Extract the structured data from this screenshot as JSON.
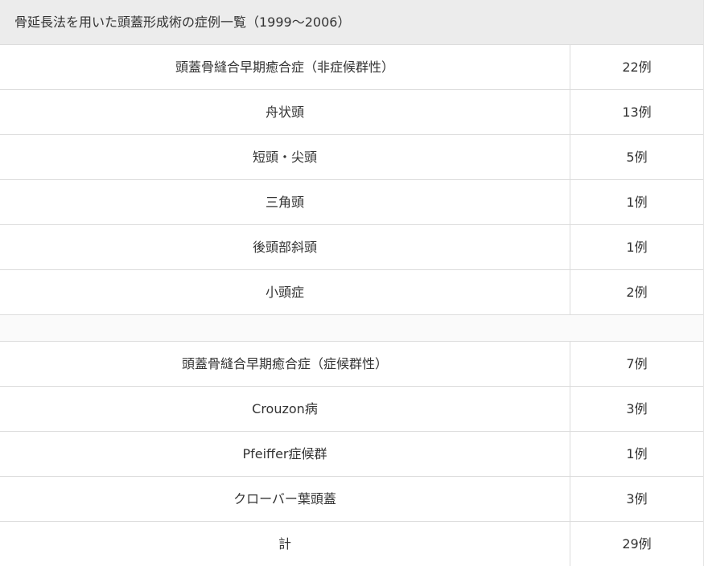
{
  "caption": "骨延長法を用いた頭蓋形成術の症例一覧（1999～2006）",
  "group1": [
    {
      "name": "頭蓋骨縫合早期癒合症（非症候群性）",
      "count": "22例"
    },
    {
      "name": "舟状頭",
      "count": "13例"
    },
    {
      "name": "短頭・尖頭",
      "count": "5例"
    },
    {
      "name": "三角頭",
      "count": "1例"
    },
    {
      "name": "後頭部斜頭",
      "count": "1例"
    },
    {
      "name": "小頭症",
      "count": "2例"
    }
  ],
  "group2": [
    {
      "name": "頭蓋骨縫合早期癒合症（症候群性）",
      "count": "7例"
    },
    {
      "name": "Crouzon病",
      "count": "3例"
    },
    {
      "name": "Pfeiffer症候群",
      "count": "1例"
    },
    {
      "name": "クローバー葉頭蓋",
      "count": "3例"
    },
    {
      "name": "計",
      "count": "29例"
    }
  ]
}
